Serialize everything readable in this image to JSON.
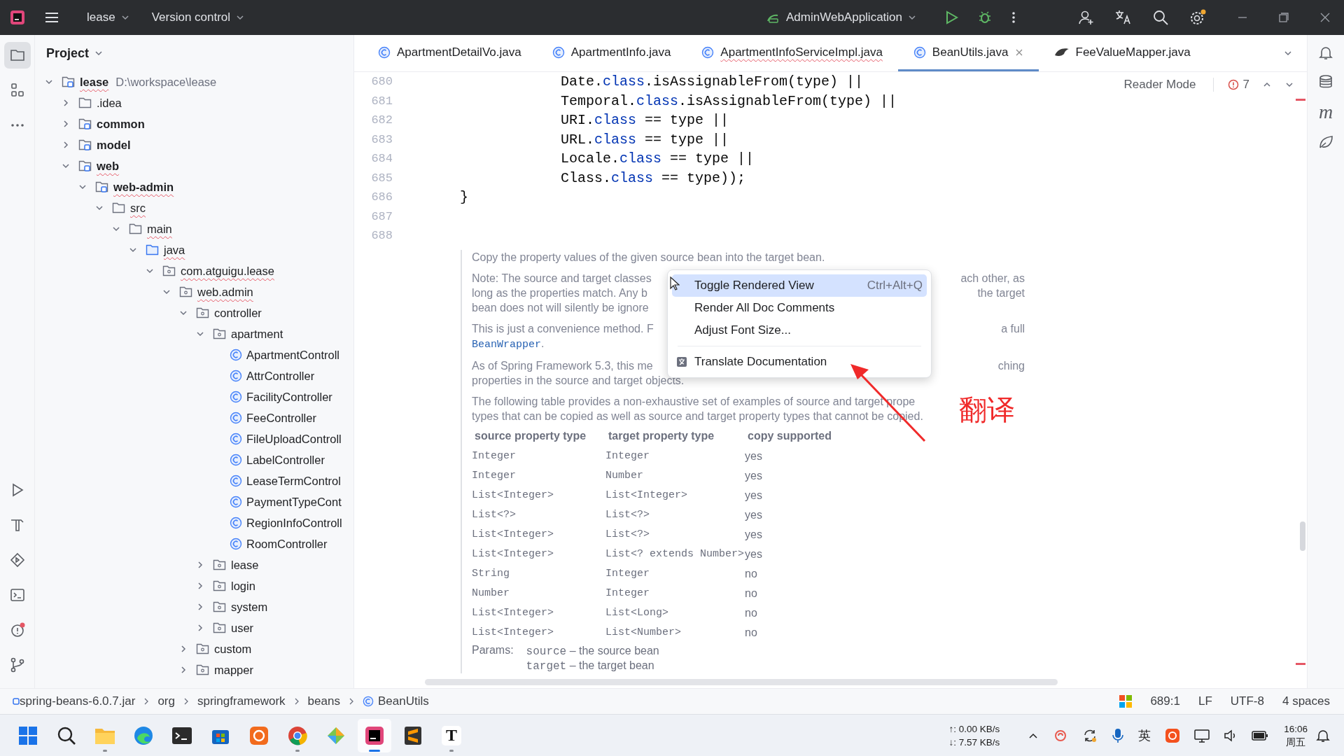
{
  "toolbar": {
    "project": "lease",
    "vcs": "Version control",
    "run_config": "AdminWebApplication",
    "settings_badge": true
  },
  "left_tools": [
    {
      "kind": "project",
      "selected": true,
      "badge": false
    },
    {
      "kind": "structure",
      "selected": false,
      "badge": false
    },
    {
      "kind": "more",
      "selected": false,
      "badge": false
    },
    {
      "kind": "run",
      "selected": false,
      "badge": false
    },
    {
      "kind": "build",
      "selected": false,
      "badge": false
    },
    {
      "kind": "services",
      "selected": false,
      "badge": false
    },
    {
      "kind": "terminal",
      "selected": false,
      "badge": false
    },
    {
      "kind": "problems",
      "selected": false,
      "badge": true
    },
    {
      "kind": "git",
      "selected": false,
      "badge": false
    }
  ],
  "right_tools": [
    {
      "kind": "notifications"
    },
    {
      "kind": "database"
    },
    {
      "kind": "maven",
      "glyph": "m"
    },
    {
      "kind": "spring"
    }
  ],
  "project": {
    "title": "Project",
    "tree": [
      {
        "label": "lease",
        "path": "D:\\workspace\\lease",
        "kind": "module",
        "expanded": true,
        "typo": true,
        "children": [
          {
            "label": ".idea",
            "kind": "folder",
            "expanded": false,
            "typo": false
          },
          {
            "label": "common",
            "kind": "module",
            "expanded": false,
            "typo": false
          },
          {
            "label": "model",
            "kind": "module",
            "expanded": false,
            "typo": false
          },
          {
            "label": "web",
            "kind": "module",
            "expanded": true,
            "typo": true,
            "children": [
              {
                "label": "web-admin",
                "kind": "module",
                "expanded": true,
                "typo": true,
                "children": [
                  {
                    "label": "src",
                    "kind": "folder",
                    "expanded": true,
                    "typo": true,
                    "children": [
                      {
                        "label": "main",
                        "kind": "folder",
                        "expanded": true,
                        "typo": true,
                        "children": [
                          {
                            "label": "java",
                            "kind": "source",
                            "expanded": true,
                            "typo": true,
                            "children": [
                              {
                                "label": "com.atguigu.lease",
                                "kind": "package",
                                "expanded": true,
                                "typo": true,
                                "children": [
                                  {
                                    "label": "web.admin",
                                    "kind": "package",
                                    "expanded": true,
                                    "typo": true,
                                    "children": [
                                      {
                                        "label": "controller",
                                        "kind": "package",
                                        "expanded": true,
                                        "typo": false,
                                        "children": [
                                          {
                                            "label": "apartment",
                                            "kind": "package",
                                            "expanded": true,
                                            "typo": false,
                                            "children": [
                                              {
                                                "label": "ApartmentControll",
                                                "kind": "class",
                                                "typo": false
                                              },
                                              {
                                                "label": "AttrController",
                                                "kind": "class",
                                                "typo": false
                                              },
                                              {
                                                "label": "FacilityController",
                                                "kind": "class",
                                                "typo": false
                                              },
                                              {
                                                "label": "FeeController",
                                                "kind": "class",
                                                "typo": false
                                              },
                                              {
                                                "label": "FileUploadControll",
                                                "kind": "class",
                                                "typo": false
                                              },
                                              {
                                                "label": "LabelController",
                                                "kind": "class",
                                                "typo": false
                                              },
                                              {
                                                "label": "LeaseTermControl",
                                                "kind": "class",
                                                "typo": false
                                              },
                                              {
                                                "label": "PaymentTypeCont",
                                                "kind": "class",
                                                "typo": false
                                              },
                                              {
                                                "label": "RegionInfoControll",
                                                "kind": "class",
                                                "typo": false
                                              },
                                              {
                                                "label": "RoomController",
                                                "kind": "class",
                                                "typo": false
                                              }
                                            ]
                                          },
                                          {
                                            "label": "lease",
                                            "kind": "package",
                                            "expanded": false,
                                            "typo": false
                                          },
                                          {
                                            "label": "login",
                                            "kind": "package",
                                            "expanded": false,
                                            "typo": false
                                          },
                                          {
                                            "label": "system",
                                            "kind": "package",
                                            "expanded": false,
                                            "typo": false
                                          },
                                          {
                                            "label": "user",
                                            "kind": "package",
                                            "expanded": false,
                                            "typo": false
                                          }
                                        ]
                                      },
                                      {
                                        "label": "custom",
                                        "kind": "package",
                                        "expanded": false,
                                        "typo": false
                                      },
                                      {
                                        "label": "mapper",
                                        "kind": "package",
                                        "expanded": false,
                                        "typo": false
                                      }
                                    ]
                                  }
                                ]
                              }
                            ]
                          }
                        ]
                      }
                    ]
                  }
                ]
              }
            ]
          }
        ]
      }
    ]
  },
  "tabs": [
    {
      "label": "ApartmentDetailVo.java",
      "kind": "class",
      "selected": false,
      "typo": false
    },
    {
      "label": "ApartmentInfo.java",
      "kind": "class",
      "selected": false,
      "typo": false
    },
    {
      "label": "ApartmentInfoServiceImpl.java",
      "kind": "class",
      "selected": false,
      "typo": true
    },
    {
      "label": "BeanUtils.java",
      "kind": "class",
      "selected": true,
      "typo": false
    },
    {
      "label": "FeeValueMapper.java",
      "kind": "mapper",
      "selected": false,
      "typo": false
    }
  ],
  "editor": {
    "reader_mode": "Reader Mode",
    "problems": "7",
    "lines": [
      {
        "number": "680",
        "tokens": [
          {
            "text": "            Date.",
            "kind": "plain"
          },
          {
            "text": "class",
            "kind": "keyword"
          },
          {
            "text": ".isAssignableFrom(type) ||",
            "kind": "plain"
          }
        ]
      },
      {
        "number": "681",
        "tokens": [
          {
            "text": "            Temporal.",
            "kind": "plain"
          },
          {
            "text": "class",
            "kind": "keyword"
          },
          {
            "text": ".isAssignableFrom(type) ||",
            "kind": "plain"
          }
        ]
      },
      {
        "number": "682",
        "tokens": [
          {
            "text": "            URI.",
            "kind": "plain"
          },
          {
            "text": "class",
            "kind": "keyword"
          },
          {
            "text": " == type ||",
            "kind": "plain"
          }
        ]
      },
      {
        "number": "683",
        "tokens": [
          {
            "text": "            URL.",
            "kind": "plain"
          },
          {
            "text": "class",
            "kind": "keyword"
          },
          {
            "text": " == type ||",
            "kind": "plain"
          }
        ]
      },
      {
        "number": "684",
        "tokens": [
          {
            "text": "            Locale.",
            "kind": "plain"
          },
          {
            "text": "class",
            "kind": "keyword"
          },
          {
            "text": " == type ||",
            "kind": "plain"
          }
        ]
      },
      {
        "number": "685",
        "tokens": [
          {
            "text": "            Class.",
            "kind": "plain"
          },
          {
            "text": "class",
            "kind": "keyword"
          },
          {
            "text": " == type));",
            "kind": "plain"
          }
        ]
      },
      {
        "number": "686",
        "tokens": [
          {
            "text": "}",
            "kind": "plain"
          }
        ]
      },
      {
        "number": "687"
      },
      {
        "number": "688"
      }
    ],
    "doc": {
      "paragraphs": [
        [
          {
            "before": [
              {
                "text": "Copy the property values of the given source bean into the target bean.",
                "kind": "text"
              }
            ]
          }
        ],
        [
          {
            "before": [
              {
                "text": "Note: The source and target classes",
                "kind": "text"
              }
            ],
            "after": [
              {
                "text": "ach other, as",
                "kind": "text"
              }
            ]
          },
          {
            "before": [
              {
                "text": "long as the properties match. Any b",
                "kind": "text"
              }
            ],
            "after": [
              {
                "text": "the target",
                "kind": "text"
              }
            ]
          },
          {
            "before": [
              {
                "text": "bean does not will silently be ignore",
                "kind": "text"
              }
            ]
          }
        ],
        [
          {
            "before": [
              {
                "text": "This is just a convenience method. F",
                "kind": "text"
              }
            ],
            "after": [
              {
                "text": "a full",
                "kind": "text"
              }
            ]
          },
          {
            "before": [
              {
                "text": "BeanWrapper",
                "kind": "link"
              },
              {
                "text": ".",
                "kind": "text"
              }
            ]
          }
        ],
        [
          {
            "before": [
              {
                "text": "As of Spring Framework 5.3, this me",
                "kind": "text"
              }
            ],
            "after": [
              {
                "text": "ching",
                "kind": "text"
              }
            ]
          },
          {
            "before": [
              {
                "text": "properties in the source and target objects.",
                "kind": "text"
              }
            ]
          }
        ],
        [
          {
            "before": [
              {
                "text": "The following table provides a non-exhaustive set of examples of source and target prope",
                "kind": "text"
              }
            ]
          },
          {
            "before": [
              {
                "text": "types that can be copied as well as source and target property types that cannot be copied.",
                "kind": "text"
              }
            ]
          }
        ]
      ],
      "table": {
        "columns": [
          "source property type",
          "target property type",
          "copy supported"
        ],
        "rows": [
          [
            "Integer",
            "Integer",
            "yes"
          ],
          [
            "Integer",
            "Number",
            "yes"
          ],
          [
            "List<Integer>",
            "List<Integer>",
            "yes"
          ],
          [
            "List<?>",
            "List<?>",
            "yes"
          ],
          [
            "List<Integer>",
            "List<?>",
            "yes"
          ],
          [
            "List<Integer>",
            "List<? extends Number>",
            "yes"
          ],
          [
            "String",
            "Integer",
            "no"
          ],
          [
            "Number",
            "Integer",
            "no"
          ],
          [
            "List<Integer>",
            "List<Long>",
            "no"
          ],
          [
            "List<Integer>",
            "List<Number>",
            "no"
          ]
        ]
      },
      "params_label": "Params:",
      "params": [
        {
          "name": "source",
          "desc": "– the source bean"
        },
        {
          "name": "target",
          "desc": "– the target bean"
        }
      ]
    }
  },
  "context_menu": {
    "items": [
      {
        "kind": "item",
        "label": "Toggle Rendered View",
        "shortcut": "Ctrl+Alt+Q",
        "selected": true
      },
      {
        "kind": "item",
        "label": "Render All Doc Comments",
        "selected": false
      },
      {
        "kind": "item",
        "label": "Adjust Font Size...",
        "selected": false
      },
      {
        "kind": "separator"
      },
      {
        "kind": "icon_item",
        "label": "Translate Documentation",
        "selected": false
      }
    ]
  },
  "annotation": {
    "text": "翻译"
  },
  "status_bar": {
    "breadcrumbs": [
      "spring-beans-6.0.7.jar",
      "org",
      "springframework",
      "beans",
      "BeanUtils"
    ],
    "position": "689:1",
    "line_separator": "LF",
    "encoding": "UTF-8",
    "indent": "4 spaces"
  },
  "taskbar": {
    "apps": [
      {
        "kind": "start",
        "running": false,
        "active": false
      },
      {
        "kind": "search",
        "running": false,
        "active": false
      },
      {
        "kind": "explorer",
        "running": true,
        "active": false
      },
      {
        "kind": "edge",
        "running": false,
        "active": false
      },
      {
        "kind": "terminal",
        "running": false,
        "active": false
      },
      {
        "kind": "store",
        "running": false,
        "active": false
      },
      {
        "kind": "ring-app",
        "running": false,
        "active": false
      },
      {
        "kind": "chrome",
        "running": true,
        "active": false
      },
      {
        "kind": "diamond-app",
        "running": false,
        "active": false
      },
      {
        "kind": "intellij",
        "running": true,
        "active": true
      },
      {
        "kind": "sublime",
        "running": false,
        "active": false
      },
      {
        "kind": "typora",
        "glyph": "T",
        "running": true,
        "active": false
      }
    ],
    "upload": "↑: 0.00 KB/s",
    "download": "↓: 7.57 KB/s",
    "tray": [
      {
        "kind": "chevron"
      },
      {
        "kind": "swirl"
      },
      {
        "kind": "sync"
      },
      {
        "kind": "microphone"
      },
      {
        "kind": "ime",
        "glyph": "英"
      },
      {
        "kind": "sogou"
      },
      {
        "kind": "monitor"
      },
      {
        "kind": "speaker"
      },
      {
        "kind": "battery"
      }
    ],
    "time": "16:06",
    "day": "周五"
  }
}
